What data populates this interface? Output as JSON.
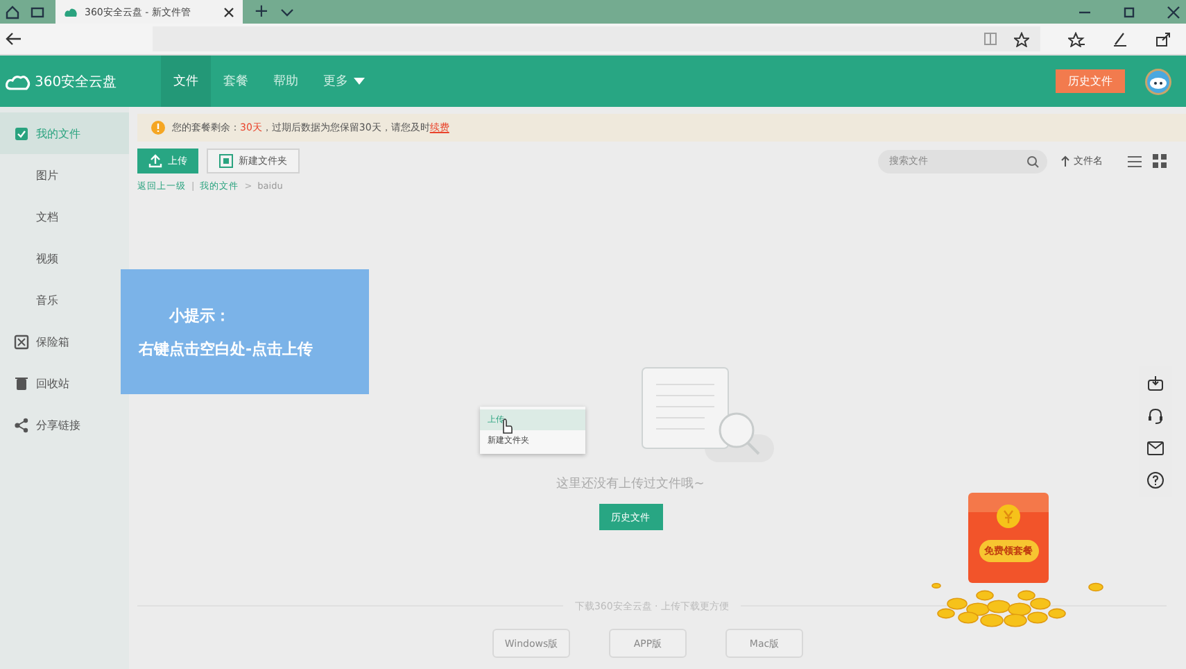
{
  "browser": {
    "tab_title": "360安全云盘 - 新文件管",
    "new_tab": "+"
  },
  "header": {
    "logo": "360安全云盘",
    "nav": [
      {
        "label": "文件",
        "selected": true
      },
      {
        "label": "套餐",
        "selected": false
      },
      {
        "label": "帮助",
        "selected": false
      },
      {
        "label": "更多",
        "selected": false,
        "dropdown": true
      }
    ],
    "history_button": "历史文件"
  },
  "sidebar": {
    "items": [
      {
        "label": "我的文件",
        "selected": true,
        "children": [
          {
            "label": "图片",
            "selected": false
          },
          {
            "label": "文档",
            "selected": false
          },
          {
            "label": "视频",
            "selected": false
          },
          {
            "label": "音乐",
            "selected": false
          }
        ]
      },
      {
        "label": "保险箱",
        "selected": false
      },
      {
        "label": "回收站",
        "selected": false
      },
      {
        "label": "分享链接",
        "selected": false
      }
    ]
  },
  "notice": {
    "prefix": "您的套餐剩余：",
    "days": "30天",
    "middle": "，过期后数据为您保留30天，请您及时",
    "link": "续费"
  },
  "toolbar": {
    "upload": "上传",
    "new_folder": "新建文件夹",
    "search": {
      "placeholder": "搜索文件"
    },
    "sort": "文件名"
  },
  "breadcrumb": {
    "back": "返回上一级",
    "separator": "|",
    "items": [
      "我的文件",
      "baidu"
    ],
    "arrow": ">"
  },
  "tip": {
    "title": "小提示：",
    "text": "右键点击空白处-点击上传"
  },
  "empty": {
    "menu": [
      "上传",
      "新建文件夹"
    ],
    "message": "这里还没有上传过文件哦~",
    "button": "历史文件"
  },
  "promo": {
    "label": "免费领套餐"
  },
  "footer": {
    "caption": "下载360安全云盘 · 上传下载更方便",
    "buttons": [
      "Windows版",
      "APP版",
      "Mac版"
    ]
  }
}
